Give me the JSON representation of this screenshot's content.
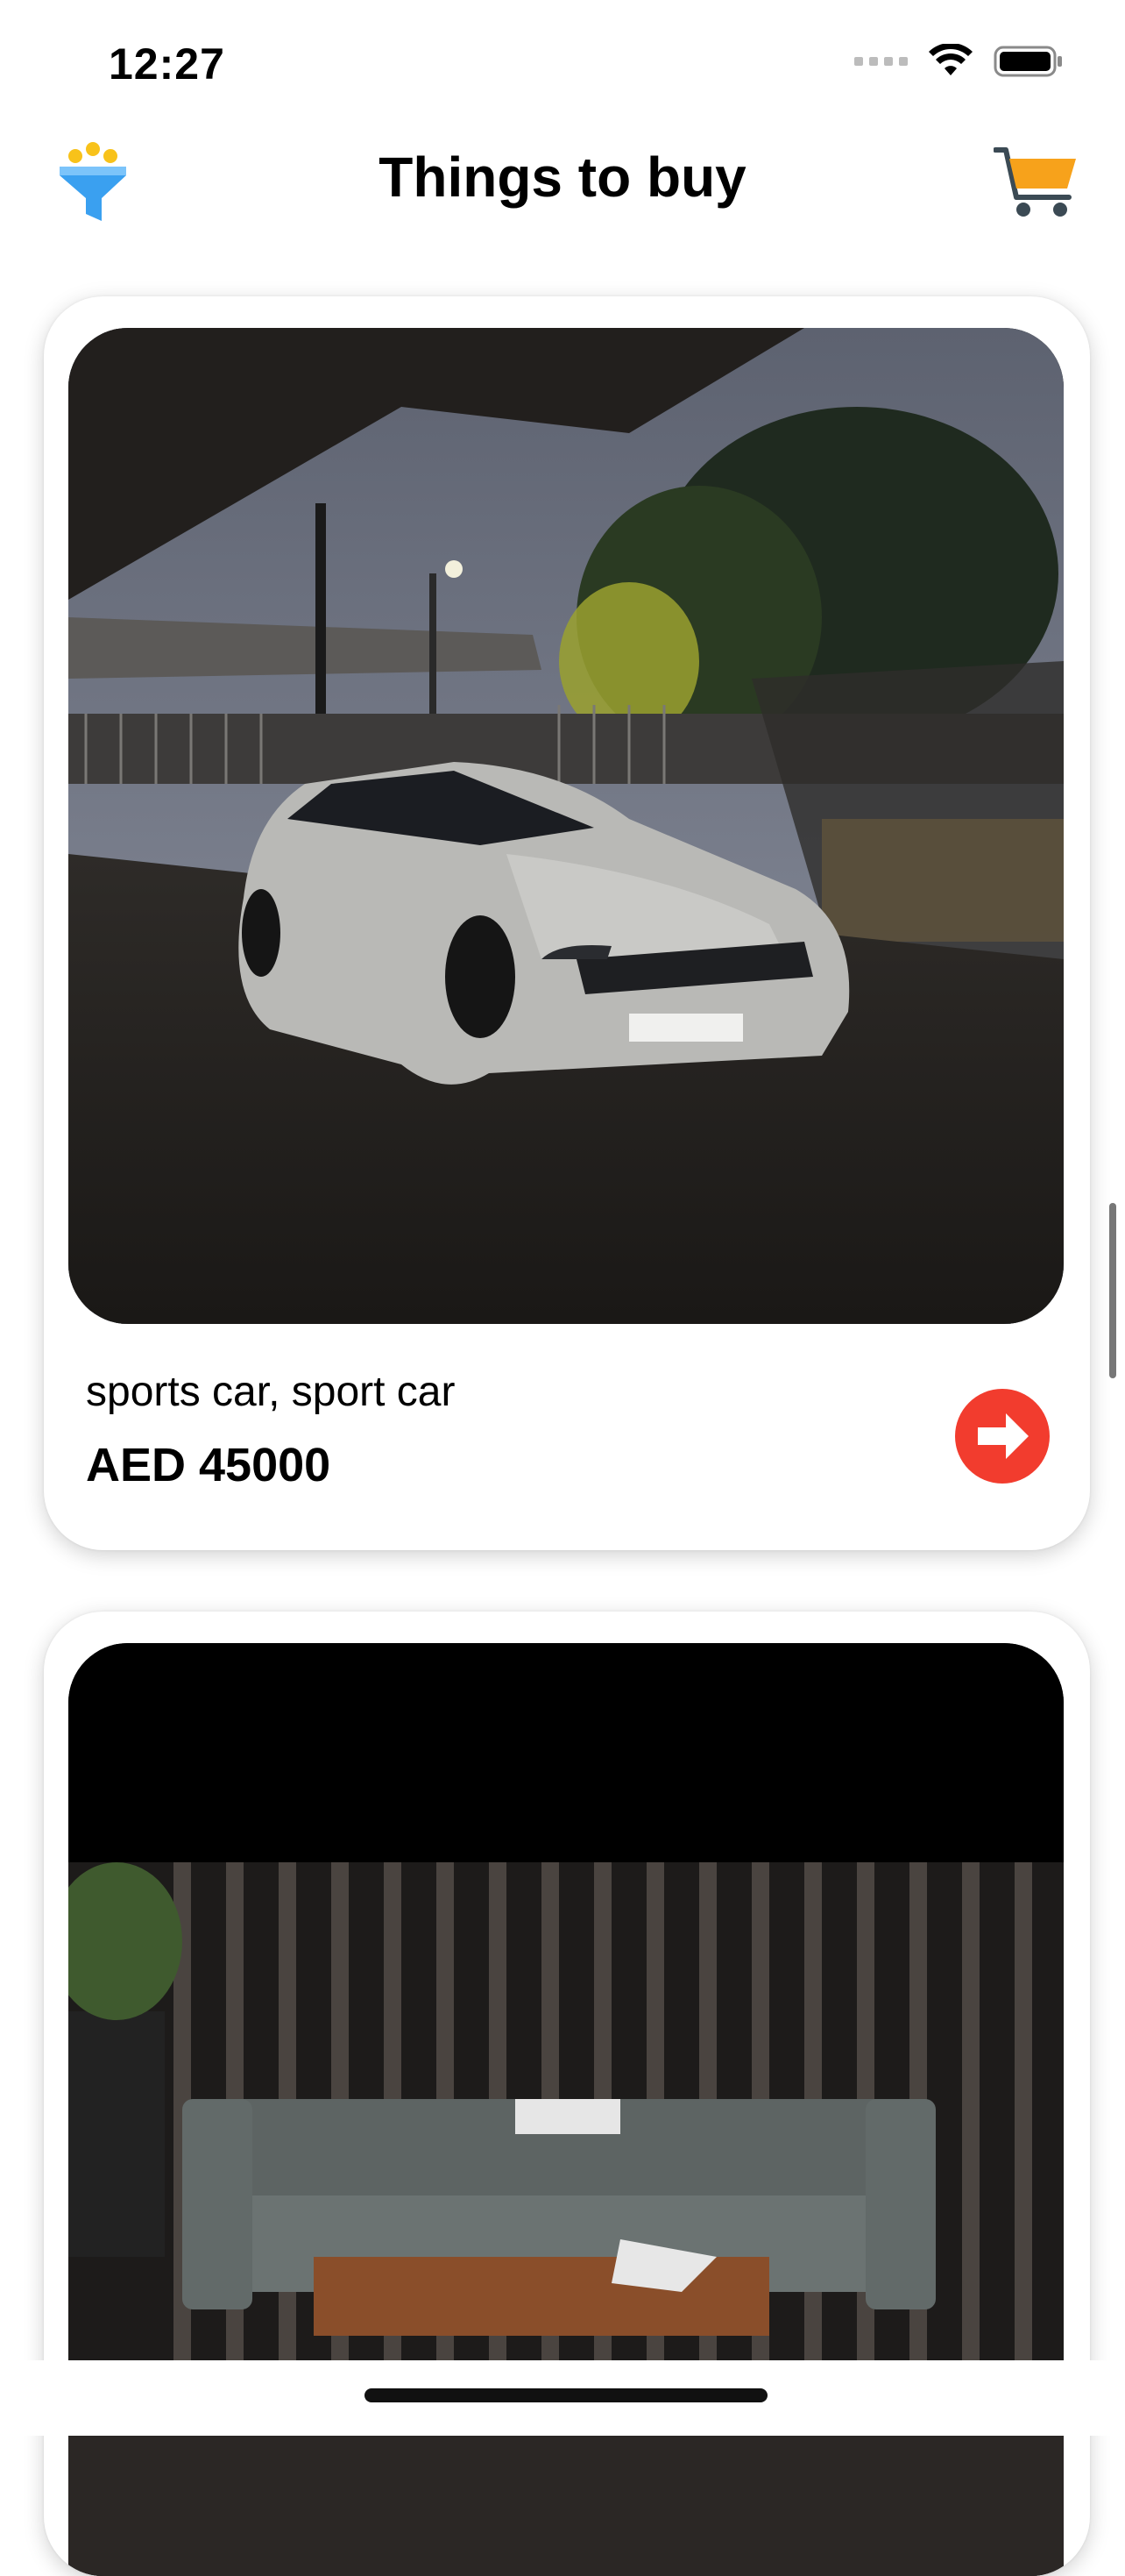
{
  "status_bar": {
    "time": "12:27"
  },
  "header": {
    "title": "Things to buy",
    "filter_icon": "filter-funnel-icon",
    "cart_icon": "shopping-cart-icon"
  },
  "colors": {
    "accent_red": "#f23c2e",
    "cart_orange": "#f7a21b",
    "filter_blue": "#3aa0f0",
    "filter_yellow": "#f8c21a"
  },
  "items": [
    {
      "name": "sports car, sport car",
      "price": "AED 45000",
      "photo": "car-photo",
      "action_icon": "arrow-right-circle-icon"
    },
    {
      "name": "",
      "price": "",
      "photo": "sofa-photo"
    }
  ]
}
